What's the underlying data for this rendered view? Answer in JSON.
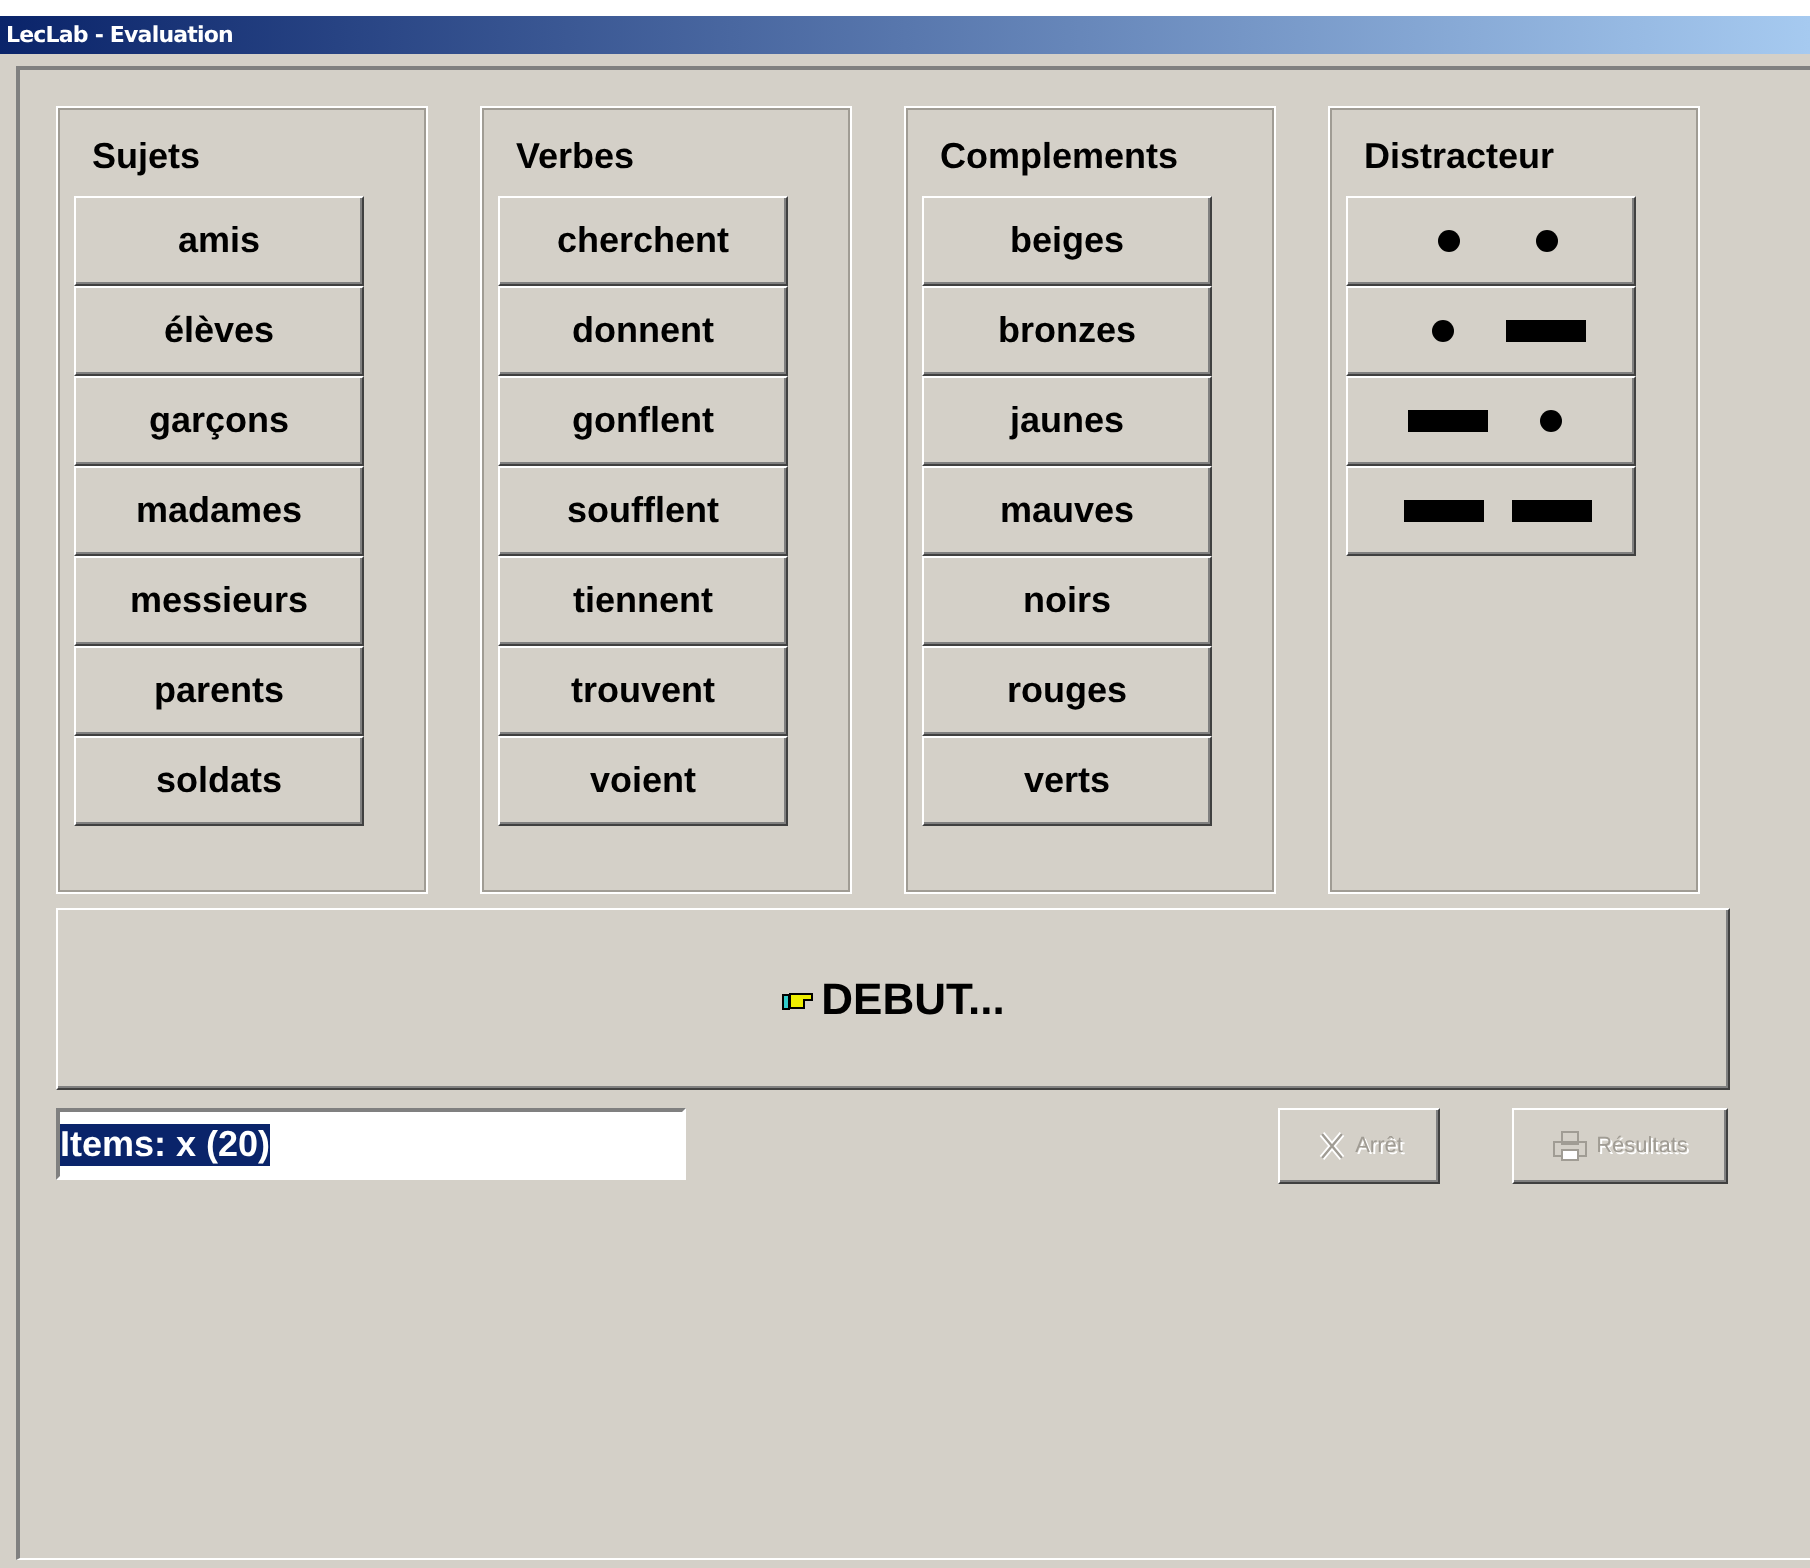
{
  "window": {
    "title": "LecLab - Evaluation"
  },
  "groups": [
    {
      "title": "Sujets",
      "items": [
        "amis",
        "élèves",
        "garçons",
        "madames",
        "messieurs",
        "parents",
        "soldats"
      ]
    },
    {
      "title": "Verbes",
      "items": [
        "cherchent",
        "donnent",
        "gonflent",
        "soufflent",
        "tiennent",
        "trouvent",
        "voient"
      ]
    },
    {
      "title": "Complements",
      "items": [
        "beiges",
        "bronzes",
        "jaunes",
        "mauves",
        "noirs",
        "rouges",
        "verts"
      ]
    }
  ],
  "distractor": {
    "title": "Distracteur",
    "items": [
      {
        "symbols": [
          {
            "kind": "dot"
          },
          {
            "kind": "dot"
          }
        ]
      },
      {
        "symbols": [
          {
            "kind": "dot"
          },
          {
            "kind": "dash"
          }
        ]
      },
      {
        "symbols": [
          {
            "kind": "dash"
          },
          {
            "kind": "dot"
          }
        ]
      },
      {
        "symbols": [
          {
            "kind": "dash"
          },
          {
            "kind": "dash"
          }
        ]
      }
    ]
  },
  "start_button": {
    "label": "DEBUT..."
  },
  "items_field": {
    "value": "Items: x (20)",
    "highlighted": true
  },
  "buttons": [
    {
      "label": "Arrêt",
      "kind": "stop",
      "disabled": true
    },
    {
      "label": "Résultats",
      "kind": "results",
      "disabled": true
    }
  ]
}
